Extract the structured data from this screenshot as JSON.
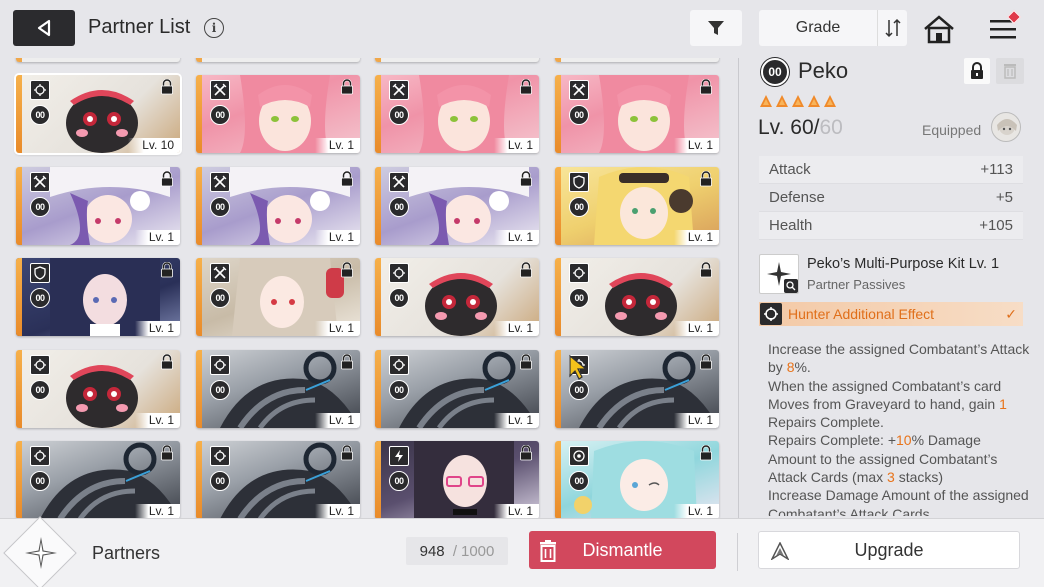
{
  "header": {
    "title": "Partner List",
    "info_icon": "info-icon",
    "filter_icon": "filter-icon",
    "sort_label": "Grade",
    "sort_icon": "sort-order-icon",
    "home_icon": "home-icon",
    "menu_icon": "menu-icon"
  },
  "grid": {
    "cards": [
      {
        "cls": "hunter",
        "level": "Lv. 10",
        "art": "peko",
        "rarity": "gold",
        "selected": true
      },
      {
        "cls": "striker",
        "level": "Lv. 1",
        "art": "pink",
        "rarity": "gold"
      },
      {
        "cls": "striker",
        "level": "Lv. 1",
        "art": "pink",
        "rarity": "gold"
      },
      {
        "cls": "striker",
        "level": "Lv. 1",
        "art": "pink",
        "rarity": "gold"
      },
      {
        "cls": "striker",
        "level": "Lv. 1",
        "art": "purple",
        "rarity": "gold"
      },
      {
        "cls": "striker",
        "level": "Lv. 1",
        "art": "purple",
        "rarity": "gold"
      },
      {
        "cls": "striker",
        "level": "Lv. 1",
        "art": "purple",
        "rarity": "gold"
      },
      {
        "cls": "defender",
        "level": "Lv. 1",
        "art": "blonde",
        "rarity": "gold"
      },
      {
        "cls": "defender",
        "level": "Lv. 1",
        "art": "navy",
        "rarity": "gold"
      },
      {
        "cls": "striker",
        "level": "Lv. 1",
        "art": "silver",
        "rarity": "gold"
      },
      {
        "cls": "hunter",
        "level": "Lv. 1",
        "art": "peko",
        "rarity": "gold"
      },
      {
        "cls": "hunter",
        "level": "Lv. 1",
        "art": "peko",
        "rarity": "gold"
      },
      {
        "cls": "hunter",
        "level": "Lv. 1",
        "art": "peko",
        "rarity": "gold"
      },
      {
        "cls": "hunter",
        "level": "Lv. 1",
        "art": "mech",
        "rarity": "gold"
      },
      {
        "cls": "hunter",
        "level": "Lv. 1",
        "art": "mech",
        "rarity": "gold"
      },
      {
        "cls": "hunter",
        "level": "Lv. 1",
        "art": "mech",
        "rarity": "gold"
      },
      {
        "cls": "hunter",
        "level": "Lv. 1",
        "art": "mech",
        "rarity": "gold"
      },
      {
        "cls": "hunter",
        "level": "Lv. 1",
        "art": "mech",
        "rarity": "gold"
      },
      {
        "cls": "psionic",
        "level": "Lv. 1",
        "art": "glasses",
        "rarity": "gold"
      },
      {
        "cls": "controller",
        "level": "Lv. 1",
        "art": "cyan",
        "rarity": "gold"
      }
    ]
  },
  "panel": {
    "grade": "00",
    "name": "Peko",
    "stars": 5,
    "level_current": "Lv. 60/",
    "level_max": "60",
    "equipped_label": "Equipped",
    "stats": [
      {
        "label": "Attack",
        "value": "+113"
      },
      {
        "label": "Defense",
        "value": "+5"
      },
      {
        "label": "Health",
        "value": "+105"
      }
    ],
    "passive_title": "Peko’s Multi-Purpose Kit Lv. 1",
    "passive_sub": "Partner Passives",
    "hunter_label": "Hunter Additional Effect",
    "desc": {
      "p1a": "Increase the assigned Combatant’s Attack by ",
      "p1h": "8",
      "p1b": "%.",
      "p2a": "When the assigned Combatant’s card Moves from Graveyard to hand, gain ",
      "p2h": "1",
      "p2b": " Repairs Complete.",
      "p3a": "Repairs Complete: +",
      "p3h": "10",
      "p3b": "% Damage Amount to the assigned Combatant’s Attack Cards (max ",
      "p3h2": "3",
      "p3c": " stacks)",
      "p4": "Increase Damage Amount of the assigned Combatant’s Attack Cards"
    }
  },
  "bottom": {
    "label": "Partners",
    "count": "948",
    "count_sep": "/",
    "count_max": "1000",
    "dismantle": "Dismantle",
    "upgrade": "Upgrade"
  }
}
